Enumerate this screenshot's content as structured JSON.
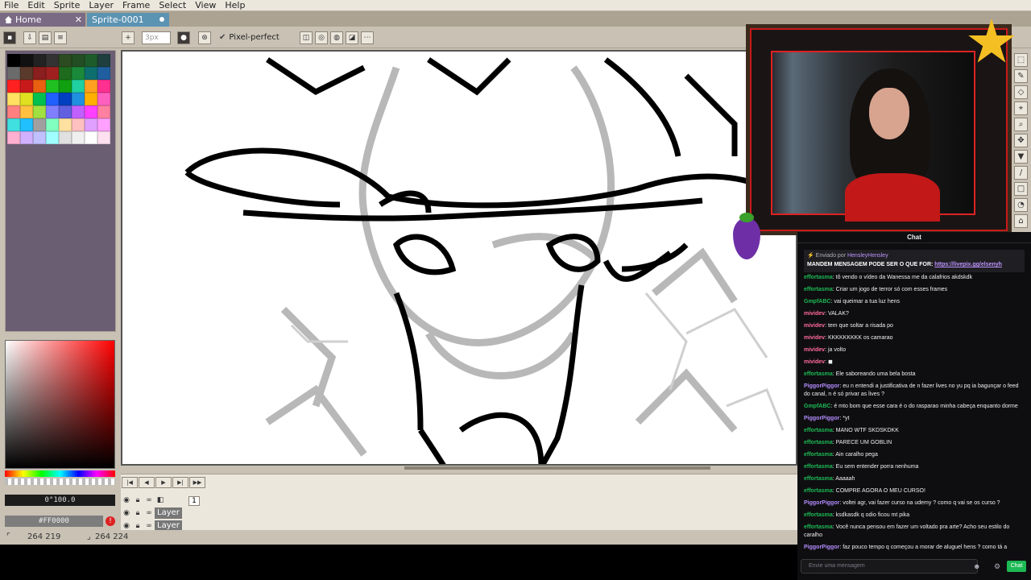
{
  "menu": [
    "File",
    "Edit",
    "Sprite",
    "Layer",
    "Frame",
    "Select",
    "View",
    "Help"
  ],
  "tabs": {
    "home": "Home",
    "sprite": "Sprite-0001"
  },
  "context": {
    "pixel_perfect": "Pixel-perfect",
    "brush_size_placeholder": "3px"
  },
  "palette_colors": [
    "#000000",
    "#111111",
    "#222222",
    "#333333",
    "#2c4b21",
    "#234d23",
    "#1d5b2b",
    "#1f3f3f",
    "#6b6b6b",
    "#5a3a2a",
    "#8b1e1e",
    "#a02020",
    "#1e6b1e",
    "#1a8a3a",
    "#0e6e6e",
    "#1f5fa0",
    "#ff2020",
    "#c81a1a",
    "#e86010",
    "#20c020",
    "#10a010",
    "#20d0a0",
    "#ffa020",
    "#ff3090",
    "#ffe060",
    "#e0e020",
    "#00c050",
    "#2060ff",
    "#0040c0",
    "#2090e0",
    "#ffb000",
    "#ff60c0",
    "#ff8080",
    "#ffc040",
    "#a0e040",
    "#8080ff",
    "#6060e0",
    "#c060ff",
    "#ff40ff",
    "#ff80a0",
    "#40e0e0",
    "#20c0ff",
    "#a0a0a0",
    "#80ffc0",
    "#ffe0a0",
    "#ffc0c0",
    "#e0a0ff",
    "#ffa0ff",
    "#ffb0d0",
    "#d0b0ff",
    "#c0c0ff",
    "#a0ffff",
    "#e0e0e0",
    "#f0f0f0",
    "#ffffff",
    "#ffe0f0"
  ],
  "color_fields": {
    "hsv": "0°100.0",
    "hex": "#FF0000"
  },
  "timeline": {
    "layer1": "Layer",
    "layer2": "Layer",
    "frame": "1"
  },
  "status": {
    "pos": "264 219",
    "size": "264 224"
  },
  "chat": {
    "title": "Chat",
    "pinned_by_prefix": "Enviado por",
    "pinned_by": "HensleyHensley",
    "pinned_msg": "MANDEM MENSAGEM PODE SER O QUE FOR:",
    "pinned_link": "https://livepix.gg/elsenyh",
    "input_placeholder": "Envie uma mensagem",
    "send_label": "Chat",
    "messages": [
      {
        "user": "effortasma",
        "color": "#1db954",
        "text": ": tô vendo o vídeo da Wanessa me da calafrios akdskdk"
      },
      {
        "user": "effortasma",
        "color": "#1db954",
        "text": ": Criar um jogo de terror só com esses frames"
      },
      {
        "user": "GmpfABC",
        "color": "#1db954",
        "text": ": vai queimar a tua luz hens"
      },
      {
        "user": "mividev",
        "color": "#ff6a9a",
        "text": ": VALAK?"
      },
      {
        "user": "mividev",
        "color": "#ff6a9a",
        "text": ": tem que soltar a risada po"
      },
      {
        "user": "mividev",
        "color": "#ff6a9a",
        "text": ": KKKKKKKKK os camarao"
      },
      {
        "user": "mividev",
        "color": "#ff6a9a",
        "text": ": ja volto"
      },
      {
        "user": "mividev",
        "color": "#ff6a9a",
        "text": ": ◼"
      },
      {
        "user": "effortasma",
        "color": "#1db954",
        "text": ": Ele saboreando uma bela bosta"
      },
      {
        "user": "PiggorPiggor",
        "color": "#b48cff",
        "text": ": eu n entendi a justificativa de n fazer lives no yu pq ia bagunçar o feed do canal, n é só privar as lives ?"
      },
      {
        "user": "GmpfABC",
        "color": "#1db954",
        "text": ": é mto bom que esse cara é o do rasparao minha cabeça enquanto dorme"
      },
      {
        "user": "PiggorPiggor",
        "color": "#b48cff",
        "text": ": *yt"
      },
      {
        "user": "effortasma",
        "color": "#1db954",
        "text": ": MANO WTF SKDSKDKK"
      },
      {
        "user": "effortasma",
        "color": "#1db954",
        "text": ": PARECE UM GOBLIN"
      },
      {
        "user": "effortasma",
        "color": "#1db954",
        "text": ": Ain caralho pega"
      },
      {
        "user": "effortasma",
        "color": "#1db954",
        "text": ": Eu sem entender porra nenhuma"
      },
      {
        "user": "effortasma",
        "color": "#1db954",
        "text": ": Aaaaah"
      },
      {
        "user": "effortasma",
        "color": "#1db954",
        "text": ": COMPRE AGORA O MEU CURSO!"
      },
      {
        "user": "PiggorPiggor",
        "color": "#b48cff",
        "text": ": voltei agr, vai fazer curso na udemy ? como q vai se os curso ?"
      },
      {
        "user": "effortasma",
        "color": "#1db954",
        "text": ": ksdkasdk q odio ficou mt pika"
      },
      {
        "user": "effortasma",
        "color": "#1db954",
        "text": ": Você nunca pensou em fazer um voltado pra arte? Acho seu estilo do caralho"
      },
      {
        "user": "PiggorPiggor",
        "color": "#b48cff",
        "text": ": faz pouco tempo q começou a morar de aluguel hens ? como tá a experiência ?"
      }
    ]
  }
}
